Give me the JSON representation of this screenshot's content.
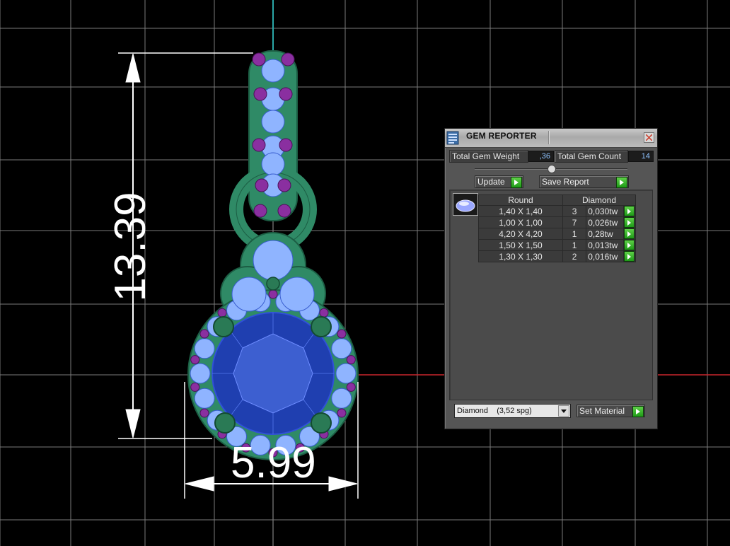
{
  "viewport": {
    "dimension_height": "13.39",
    "dimension_width": "5.99",
    "colors": {
      "background": "#000000",
      "grid": "#7a7a7a",
      "axis_x": "#c8262c",
      "axis_y": "#2aa7a7",
      "metal": "#2f8a66",
      "gem_center": "#1f3fb0",
      "accent_stones": "#8a2fa0",
      "small_stones": "#8fb4ff"
    }
  },
  "panel": {
    "title": "GEM REPORTER",
    "total_gem_weight_label": "Total Gem Weight",
    "total_gem_weight_value": ",36",
    "total_gem_count_label": "Total Gem Count",
    "total_gem_count_value": "14",
    "update_label": "Update",
    "save_report_label": "Save Report",
    "table": {
      "headers": [
        "Round",
        "Diamond"
      ],
      "rows": [
        {
          "size": "1,40 X 1,40",
          "count": "3",
          "weight": "0,030tw"
        },
        {
          "size": "1,00 X 1,00",
          "count": "7",
          "weight": "0,026tw"
        },
        {
          "size": "4,20 X 4,20",
          "count": "1",
          "weight": "0,28tw"
        },
        {
          "size": "1,50 X 1,50",
          "count": "1",
          "weight": "0,013tw"
        },
        {
          "size": "1,30 X 1,30",
          "count": "2",
          "weight": "0,016tw"
        }
      ]
    },
    "material_select_value": "Diamond    (3,52 spg)",
    "set_material_label": "Set Material"
  }
}
